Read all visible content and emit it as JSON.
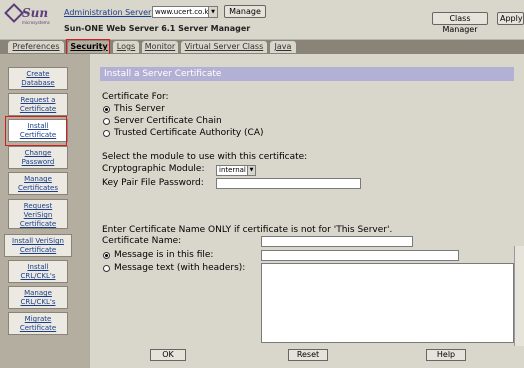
{
  "header": {
    "logo_text": "Sun",
    "logo_sub": "microsystems",
    "admin_link": "Administration Server",
    "server_value": "www.ucert.co.kr",
    "manage_label": "Manage",
    "product_title": "Sun-ONE Web Server 6.1 Server Manager",
    "class_manager_label": "Class Manager",
    "apply_label": "Apply"
  },
  "tabs": [
    {
      "label": "Preferences"
    },
    {
      "label": "Security",
      "active": true
    },
    {
      "label": "Logs"
    },
    {
      "label": "Monitor"
    },
    {
      "label": "Virtual Server Class"
    },
    {
      "label": "Java"
    }
  ],
  "sidebar": {
    "items": [
      {
        "label": "Create Database"
      },
      {
        "label": "Request a Certificate"
      },
      {
        "label": "Install Certificate",
        "active": true
      },
      {
        "label": "Change Password"
      },
      {
        "label": "Manage Certificates"
      },
      {
        "label": "Request VeriSign Certificate"
      },
      {
        "label": "Install VeriSign Certificate"
      },
      {
        "label": "Install CRL/CKL's"
      },
      {
        "label": "Manage CRL/CKL's"
      },
      {
        "label": "Migrate Certificate"
      }
    ]
  },
  "main": {
    "section_title": "Install a Server Certificate",
    "cert_for_label": "Certificate For:",
    "cert_for_options": [
      {
        "label": "This Server",
        "checked": true
      },
      {
        "label": "Server Certificate Chain",
        "checked": false
      },
      {
        "label": "Trusted Certificate Authority (CA)",
        "checked": false
      }
    ],
    "module_prompt": "Select the module to use with this certificate:",
    "module_label": "Cryptographic Module:",
    "module_value": "internal",
    "password_label": "Key Pair File Password:",
    "cert_name_prompt": "Enter Certificate Name ONLY if certificate is not for 'This Server'.",
    "cert_name_label": "Certificate Name:",
    "message_file_label": "Message is in this file:",
    "message_text_label": "Message text (with headers):",
    "ok_label": "OK",
    "reset_label": "Reset",
    "help_label": "Help"
  },
  "colors": {
    "header_bg": "#d9d6cc",
    "sidebar_bg": "#b4aea0",
    "section_bar": "#b3b0d6",
    "highlight_box": "#d21e1e",
    "link": "#1a3f8a"
  }
}
